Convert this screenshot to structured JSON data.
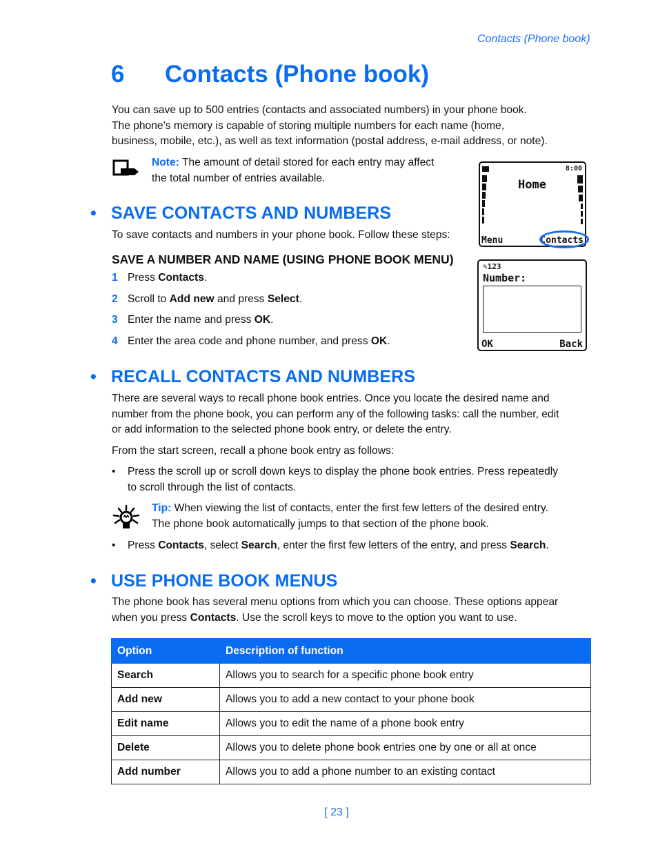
{
  "running_head": "Contacts (Phone book)",
  "chapter": {
    "number": "6",
    "title": "Contacts (Phone book)"
  },
  "intro": [
    "You can save up to 500 entries (contacts and associated numbers) in your phone book.",
    "The phone’s memory is capable of storing multiple numbers for each name (home,",
    "business, mobile, etc.), as well as text information (postal address, e-mail address, or note)."
  ],
  "note": {
    "icon": "note-icon",
    "label": "Note:",
    "line1": " The amount of detail stored for each entry may affect",
    "line2": "the total number of entries available."
  },
  "phone_screens": [
    {
      "title": "Home",
      "time": "8:00",
      "left_softkey": "Menu",
      "right_softkey": "Contacts",
      "highlighted": "Contacts"
    },
    {
      "indicator": "123",
      "label": "Number:",
      "left_softkey": "OK",
      "right_softkey": "Back"
    }
  ],
  "sections": {
    "save": {
      "bullet": "•",
      "heading": "SAVE CONTACTS AND NUMBERS",
      "intro": "To save contacts and numbers in your phone book. Follow these steps:",
      "subheading": "SAVE A NUMBER AND NAME (USING PHONE BOOK MENU)",
      "steps": [
        {
          "n": "1",
          "parts": [
            [
              "Press ",
              false
            ],
            [
              "Contacts",
              true
            ],
            [
              ".",
              false
            ]
          ]
        },
        {
          "n": "2",
          "parts": [
            [
              "Scroll to ",
              false
            ],
            [
              "Add new",
              true
            ],
            [
              " and press ",
              false
            ],
            [
              "Select",
              true
            ],
            [
              ".",
              false
            ]
          ]
        },
        {
          "n": "3",
          "parts": [
            [
              "Enter the name and press ",
              false
            ],
            [
              "OK",
              true
            ],
            [
              ".",
              false
            ]
          ]
        },
        {
          "n": "4",
          "parts": [
            [
              "Enter the area code and phone number, and press ",
              false
            ],
            [
              "OK",
              true
            ],
            [
              ".",
              false
            ]
          ]
        }
      ]
    },
    "recall": {
      "bullet": "•",
      "heading": "RECALL CONTACTS AND NUMBERS",
      "p1": [
        "There are several ways to recall phone book entries. Once you locate the desired name and",
        "number from the phone book, you can perform any of the following tasks: call the number, edit",
        "or add information to the selected phone book entry, or delete the entry."
      ],
      "p2": "From the start screen, recall a phone book entry as follows:",
      "bullet1": [
        "Press the scroll up or scroll down keys to display the phone book entries. Press repeatedly",
        "to scroll through the list of contacts."
      ],
      "tip": {
        "icon": "lightbulb-icon",
        "label": "Tip:",
        "line1": " When viewing the list of contacts, enter the first few letters of the desired entry.",
        "line2": "The phone book automatically jumps to that section of the phone book."
      },
      "bullet2": [
        [
          "Press ",
          false
        ],
        [
          "Contacts",
          true
        ],
        [
          ", select ",
          false
        ],
        [
          "Search",
          true
        ],
        [
          ", enter the first few letters of the entry, and press ",
          false
        ],
        [
          "Search",
          true
        ],
        [
          ".",
          false
        ]
      ]
    },
    "menus": {
      "bullet": "•",
      "heading": "USE PHONE BOOK MENUS",
      "p": [
        [
          [
            "The phone book has several menu options from which you can choose. These options appear",
            false
          ]
        ],
        [
          [
            "when you press ",
            false
          ],
          [
            "Contacts",
            true
          ],
          [
            ". Use the scroll keys to move to the option you want to use.",
            false
          ]
        ]
      ],
      "table": {
        "headers": [
          "Option",
          "Description of function"
        ],
        "rows": [
          [
            "Search",
            "Allows you to search for a specific phone book entry"
          ],
          [
            "Add new",
            "Allows you to add a new contact to your phone book"
          ],
          [
            "Edit name",
            "Allows you to edit the name of a phone book entry"
          ],
          [
            "Delete",
            "Allows you to delete phone book entries one by one or all at once"
          ],
          [
            "Add number",
            "Allows you to add a phone number to an existing contact"
          ]
        ]
      }
    }
  },
  "page_number": "[ 23 ]",
  "colors": {
    "accent": "#0a6cf0",
    "text": "#111111",
    "highlight_circle": "#1a6ff0"
  }
}
